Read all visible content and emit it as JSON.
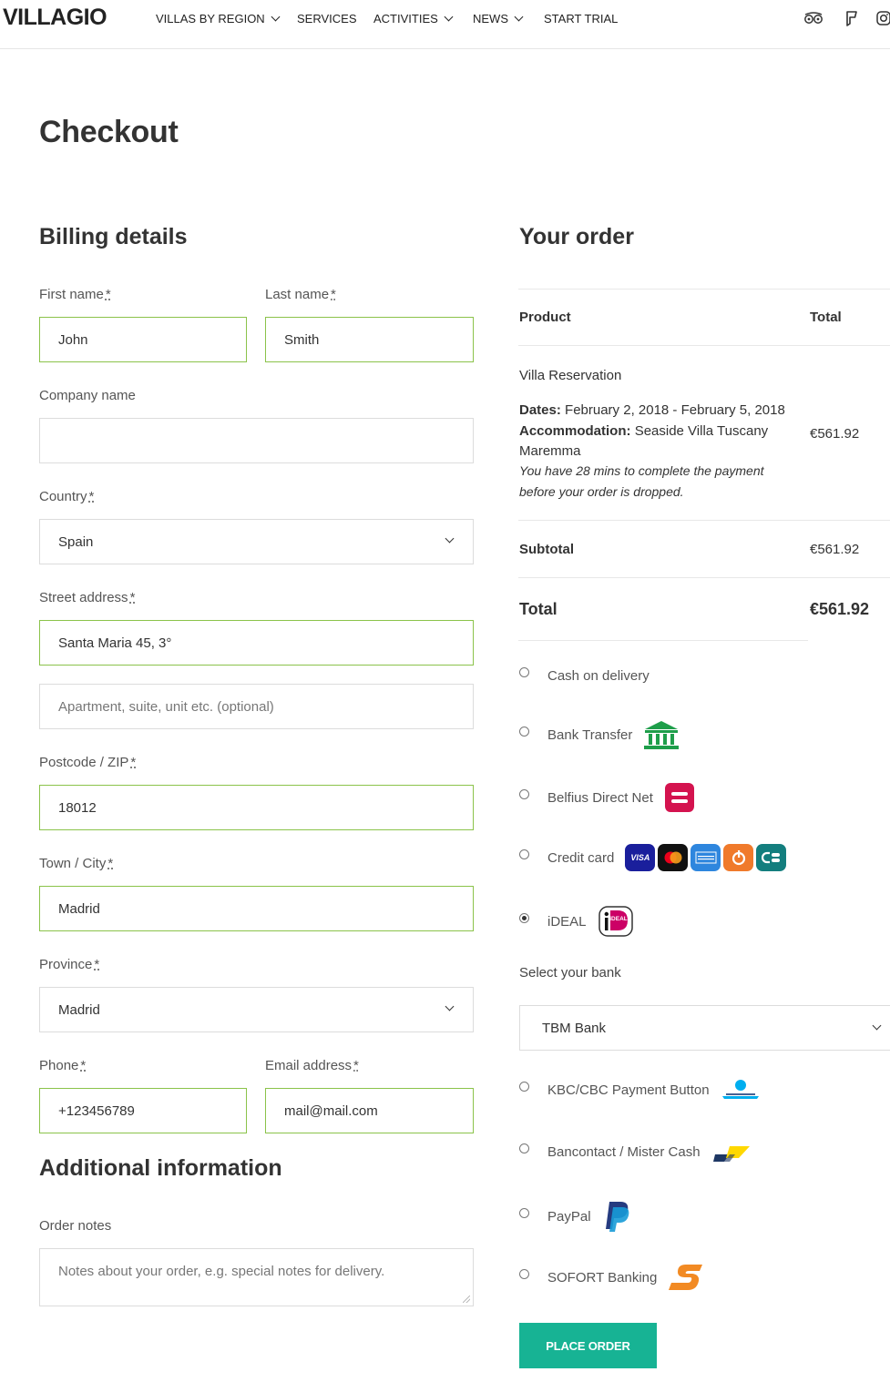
{
  "header": {
    "logo": "VILLAGIO",
    "nav": [
      {
        "label": "VILLAS BY REGION",
        "dropdown": true
      },
      {
        "label": "SERVICES",
        "dropdown": false
      },
      {
        "label": "ACTIVITIES",
        "dropdown": true
      },
      {
        "label": "NEWS",
        "dropdown": true
      },
      {
        "label": "START TRIAL",
        "dropdown": false
      }
    ],
    "icons": [
      "tripadvisor-icon",
      "foursquare-icon",
      "instagram-icon"
    ]
  },
  "page_title": "Checkout",
  "billing": {
    "title": "Billing details",
    "required_mark": "*",
    "first_name": {
      "label": "First name",
      "value": "John"
    },
    "last_name": {
      "label": "Last name",
      "value": "Smith"
    },
    "company": {
      "label": "Company name",
      "value": ""
    },
    "country": {
      "label": "Country",
      "value": "Spain"
    },
    "street": {
      "label": "Street address",
      "value": "Santa Maria 45, 3°",
      "placeholder2": "Apartment, suite, unit etc. (optional)"
    },
    "postcode": {
      "label": "Postcode / ZIP",
      "value": "18012"
    },
    "city": {
      "label": "Town / City",
      "value": "Madrid"
    },
    "province": {
      "label": "Province",
      "value": "Madrid"
    },
    "phone": {
      "label": "Phone",
      "value": "+123456789"
    },
    "email": {
      "label": "Email address",
      "value": "mail@mail.com"
    }
  },
  "additional": {
    "title": "Additional information",
    "notes_label": "Order notes",
    "notes_placeholder": "Notes about your order, e.g. special notes for delivery."
  },
  "order": {
    "title": "Your order",
    "col_product": "Product",
    "col_total": "Total",
    "item_name": "Villa Reservation",
    "dates_label": "Dates:",
    "dates_value": "February 2, 2018 - February 5, 2018",
    "accom_label": "Accommodation:",
    "accom_value": "Seaside Villa Tuscany",
    "accom_value2": "Maremma",
    "notice_line1": "You have 28 mins to complete the payment",
    "notice_line2": "before your order is dropped.",
    "item_total": "€561.92",
    "subtotal_label": "Subtotal",
    "subtotal_value": "€561.92",
    "total_label": "Total",
    "total_value": "€561.92"
  },
  "payment": {
    "cash": "Cash on delivery",
    "bank_transfer": "Bank Transfer",
    "belfius": "Belfius Direct Net",
    "credit_card": "Credit card",
    "ideal": "iDEAL",
    "ideal_logo_text": "iDEAL",
    "select_bank_label": "Select your bank",
    "selected_bank": "TBM Bank",
    "kbc": "KBC/CBC Payment Button",
    "bancontact": "Bancontact / Mister Cash",
    "paypal": "PayPal",
    "sofort": "SOFORT Banking",
    "selected_method": "iDEAL",
    "card_badges": [
      "VISA",
      "mastercard",
      "AMERICAN EXPRESS",
      "discover",
      "CB"
    ],
    "visa_text": "VISA"
  },
  "place_order": "PLACE ORDER",
  "colors": {
    "accent": "#17b394",
    "valid_border": "#8bc34a"
  }
}
